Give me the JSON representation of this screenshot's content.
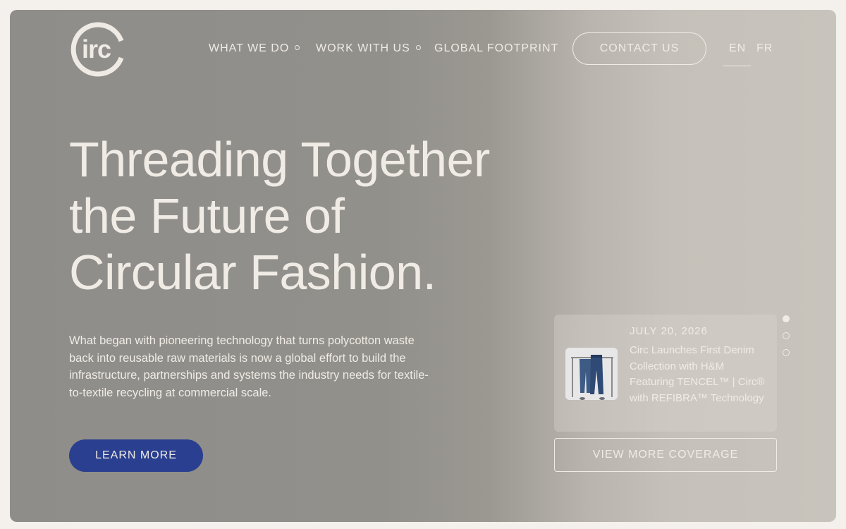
{
  "logo": {
    "text": "irc",
    "alt": "Circ"
  },
  "nav": {
    "items": [
      {
        "label": "WHAT WE DO",
        "has_dropdown": true
      },
      {
        "label": "WORK WITH US",
        "has_dropdown": true
      },
      {
        "label": "GLOBAL FOOTPRINT",
        "has_dropdown": false
      }
    ],
    "contact_label": "CONTACT US",
    "languages": [
      "EN",
      "FR"
    ],
    "active_language": "EN"
  },
  "hero": {
    "headline_lines": [
      "Threading Together",
      "the Future of",
      "Circular Fashion."
    ],
    "body": "What began with pioneering technology that turns polycotton waste back into reusable raw materials is now a global effort to build the infrastructure, partnerships and systems the industry needs for textile-to-textile recycling at commercial scale.",
    "cta_label": "LEARN MORE"
  },
  "news": {
    "date": "JULY 20, 2026",
    "title": "Circ Launches First Denim Collection with H&M Featuring TENCEL™ | Circ® with REFIBRA™ Technology",
    "thumbnail_icon": "denim-jeans-image",
    "view_more_label": "VIEW MORE COVERAGE"
  },
  "pager": {
    "count": 3,
    "active_index": 0
  },
  "colors": {
    "text": "#f0ece5",
    "accent_button": "#2a3f8f",
    "page_background": "#f4f1ec"
  }
}
